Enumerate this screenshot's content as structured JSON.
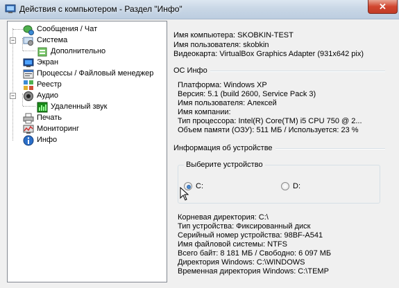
{
  "window": {
    "title": "Действия с компьютером - Раздел \"Инфо\"",
    "close_glyph": "✕"
  },
  "tree": {
    "items": [
      {
        "label": "Сообщения / Чат",
        "icon": "chat-icon"
      },
      {
        "label": "Система",
        "icon": "system-icon"
      },
      {
        "label": "Дополнительно",
        "icon": "advanced-icon"
      },
      {
        "label": "Экран",
        "icon": "monitor-icon"
      },
      {
        "label": "Процессы / Файловый менеджер",
        "icon": "processes-icon"
      },
      {
        "label": "Реестр",
        "icon": "registry-icon"
      },
      {
        "label": "Аудио",
        "icon": "audio-icon"
      },
      {
        "label": "Удаленный звук",
        "icon": "remote-sound-icon"
      },
      {
        "label": "Печать",
        "icon": "printer-icon"
      },
      {
        "label": "Мониторинг",
        "icon": "monitoring-icon"
      },
      {
        "label": "Инфо",
        "icon": "info-icon"
      }
    ]
  },
  "computer": {
    "rows": [
      "Имя компьютера:  SKOBKIN-TEST",
      "Имя пользователя:  skobkin",
      "Видеокарта:  VirtualBox Graphics Adapter (931x642 pix)"
    ]
  },
  "os": {
    "header": "ОС Инфо",
    "rows": [
      "Платформа:  Windows XP",
      "Версия:  5.1 (build 2600, Service Pack 3)",
      "Имя пользователя:  Алексей",
      "Имя компании:",
      "Тип процессора:  Intel(R) Core(TM) i5 CPU        750  @ 2...",
      "Объем памяти (ОЗУ):   511 МБ  /  Используется: 23 %"
    ]
  },
  "device": {
    "header": "Информация об устройстве",
    "group_title": "Выберите устройство",
    "radios": [
      {
        "label": "C:",
        "checked": true
      },
      {
        "label": "D:",
        "checked": false
      }
    ],
    "rows": [
      "Корневая директория:   C:\\",
      "Тип устройства:   Фиксированный диск",
      "Серийный номер устройства:   98BF-A541",
      "Имя файловой системы:   NTFS",
      "Всего байт:   8 181 МБ  /  Свободно: 6 097 МБ",
      "Директория Windows:   C:\\WINDOWS",
      "Временная директория Windows:   C:\\TEMP"
    ]
  }
}
